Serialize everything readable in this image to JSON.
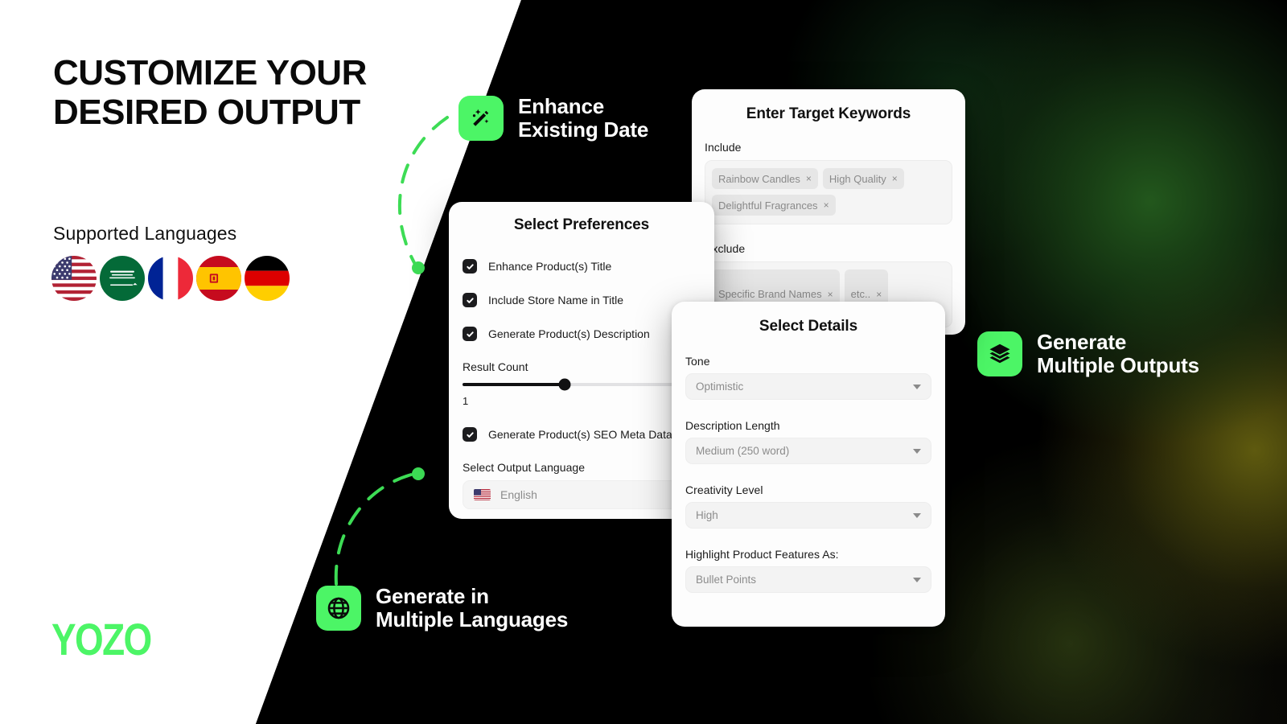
{
  "headline": {
    "line1": "CUSTOMIZE YOUR",
    "line2": "DESIRED OUTPUT"
  },
  "supported_languages": {
    "label": "Supported Languages",
    "flags": [
      "united-states-flag",
      "saudi-arabia-flag",
      "france-flag",
      "spain-flag",
      "germany-flag"
    ]
  },
  "logo": {
    "text": "YOZO",
    "color": "#4cf566"
  },
  "badges": [
    {
      "id": "enhance",
      "icon": "magic-wand-icon",
      "line1": "Enhance",
      "line2": "Existing Date"
    },
    {
      "id": "languages",
      "icon": "globe-icon",
      "line1": "Generate in",
      "line2": "Multiple Languages"
    },
    {
      "id": "outputs",
      "icon": "layers-icon",
      "line1": "Generate",
      "line2": "Multiple Outputs"
    }
  ],
  "keywords_card": {
    "title": "Enter Target Keywords",
    "include_label": "Include",
    "include_chips": [
      "Rainbow Candles",
      "High Quality",
      "Delightful Fragrances"
    ],
    "exclude_label": "Exclude",
    "exclude_chips": [
      "Specific Brand Names",
      "etc.."
    ],
    "chip_remove": "×"
  },
  "preferences_card": {
    "title": "Select Preferences",
    "checkboxes": [
      {
        "label": "Enhance Product(s) Title",
        "checked": true
      },
      {
        "label": "Include Store Name in Title",
        "checked": true
      },
      {
        "label": "Generate Product(s) Description",
        "checked": true
      }
    ],
    "result_count_label": "Result Count",
    "result_count_value": "1",
    "slider_percent": 43,
    "seo_checkbox": {
      "label": "Generate Product(s) SEO Meta Data",
      "checked": true
    },
    "output_language_label": "Select Output Language",
    "output_language_value": "English",
    "output_language_flag": "united-states-flag"
  },
  "details_card": {
    "title": "Select Details",
    "fields": [
      {
        "label": "Tone",
        "value": "Optimistic"
      },
      {
        "label": "Description Length",
        "value": "Medium (250 word)"
      },
      {
        "label": "Creativity Level",
        "value": "High"
      },
      {
        "label": "Highlight Product Features As:",
        "value": "Bullet Points"
      }
    ]
  },
  "theme": {
    "accent_green": "#4cf566",
    "dark_bg": "#000000",
    "light_bg": "#ffffff",
    "checkbox_dark": "#1c1c1e"
  }
}
